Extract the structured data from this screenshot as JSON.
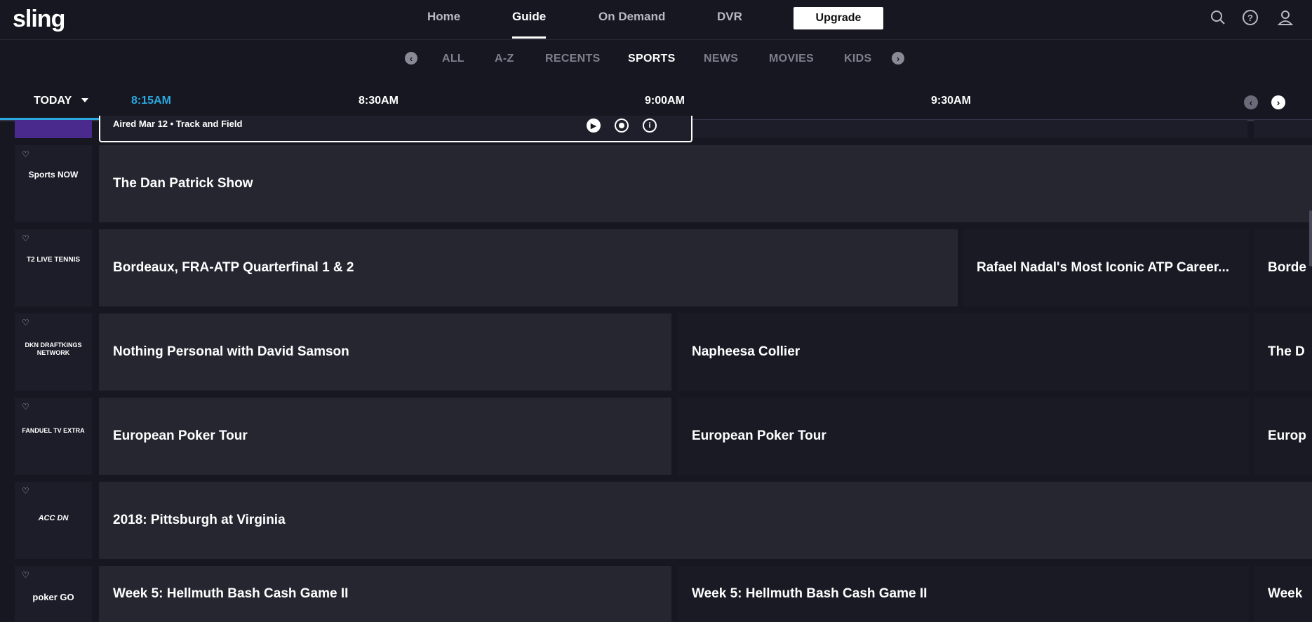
{
  "app": {
    "logo": "sling"
  },
  "nav": {
    "items": [
      "Home",
      "Guide",
      "On Demand",
      "DVR"
    ],
    "active": "Guide",
    "upgrade_label": "Upgrade"
  },
  "top_icons": [
    "search-icon",
    "help-icon",
    "account-icon"
  ],
  "categories": {
    "items": [
      "ALL",
      "A-Z",
      "RECENTS",
      "SPORTS",
      "NEWS",
      "MOVIES",
      "KIDS"
    ],
    "active": "SPORTS"
  },
  "timebar": {
    "day_label": "TODAY",
    "current_time": "8:15AM",
    "slots": [
      "8:30AM",
      "9:00AM",
      "9:30AM"
    ]
  },
  "popup": {
    "text": "Aired Mar 12 • Track and Field",
    "icons": [
      "play-icon",
      "record-icon",
      "info-icon"
    ]
  },
  "rows": [
    {
      "channel_logo": "Sports NOW",
      "programs": [
        {
          "title": "The Dan Patrick Show"
        }
      ]
    },
    {
      "channel_logo": "T2 LIVE TENNIS",
      "programs": [
        {
          "title": "Bordeaux, FRA-ATP Quarterfinal 1 & 2"
        },
        {
          "title": "Rafael Nadal's Most Iconic ATP Career..."
        },
        {
          "title": "Borde"
        }
      ]
    },
    {
      "channel_logo": "DKN DRAFTKINGS NETWORK",
      "programs": [
        {
          "title": "Nothing Personal with David Samson"
        },
        {
          "title": "Napheesa Collier"
        },
        {
          "title": "The D"
        }
      ]
    },
    {
      "channel_logo": "FANDUEL TV EXTRA",
      "programs": [
        {
          "title": "European Poker Tour"
        },
        {
          "title": "European Poker Tour"
        },
        {
          "title": "Europ"
        }
      ]
    },
    {
      "channel_logo": "ACC DN",
      "programs": [
        {
          "title": "2018: Pittsburgh at Virginia"
        }
      ]
    },
    {
      "channel_logo": "poker GO",
      "programs": [
        {
          "title": "Week 5: Hellmuth Bash Cash Game II"
        },
        {
          "title": "Week 5: Hellmuth Bash Cash Game II"
        },
        {
          "title": "Week"
        }
      ]
    }
  ]
}
